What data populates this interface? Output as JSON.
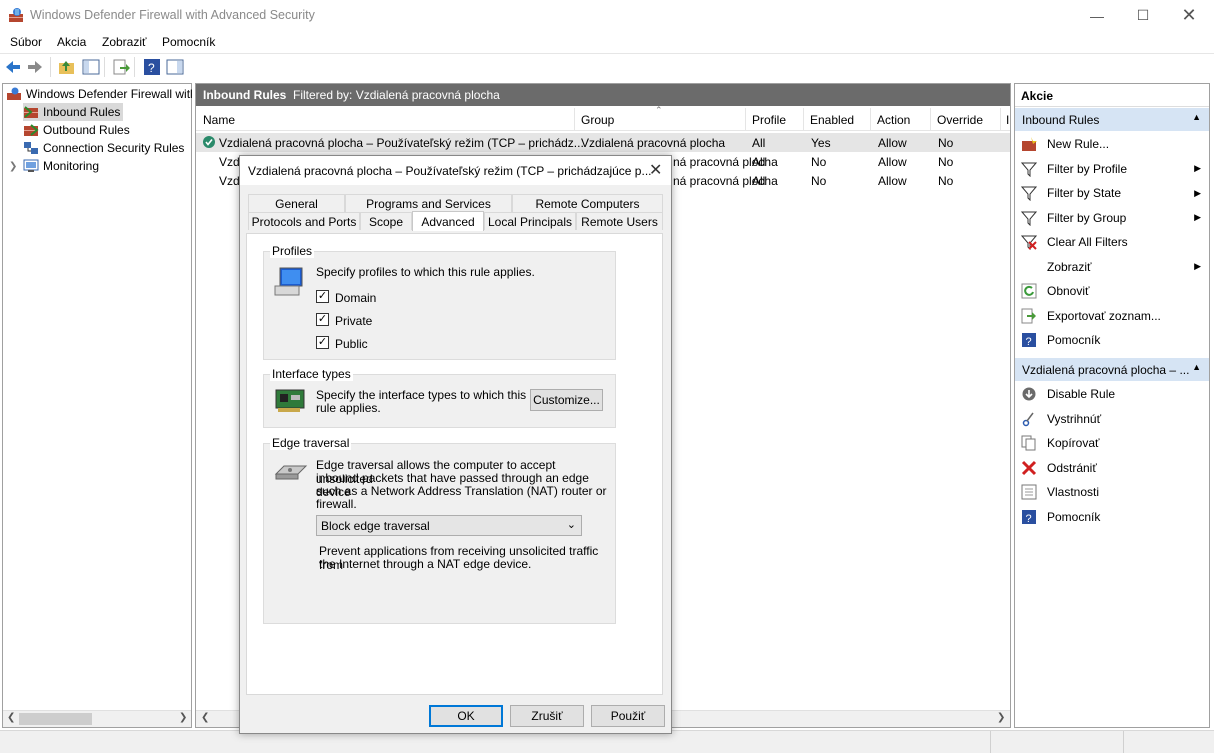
{
  "window": {
    "title": "Windows Defender Firewall with Advanced Security"
  },
  "menu": [
    "Súbor",
    "Akcia",
    "Zobraziť",
    "Pomocník"
  ],
  "tree": {
    "root": "Windows Defender Firewall witl",
    "items": [
      "Inbound Rules",
      "Outbound Rules",
      "Connection Security Rules",
      "Monitoring"
    ]
  },
  "center": {
    "header_title": "Inbound Rules",
    "header_filter": "Filtered by: Vzdialená pracovná plocha",
    "columns": [
      "Name",
      "Group",
      "Profile",
      "Enabled",
      "Action",
      "Override",
      "I"
    ],
    "rows": [
      {
        "name": "Vzdialená pracovná plocha – Používateľský režim (TCP – prichádz...",
        "group": "Vzdialená pracovná plocha",
        "profile": "All",
        "enabled": "Yes",
        "action": "Allow",
        "override": "No"
      },
      {
        "name": "Vzd",
        "group": "ná pracovná plocha",
        "profile": "All",
        "enabled": "No",
        "action": "Allow",
        "override": "No"
      },
      {
        "name": "Vzd",
        "group": "ná pracovná plocha",
        "profile": "All",
        "enabled": "No",
        "action": "Allow",
        "override": "No"
      }
    ]
  },
  "actions": {
    "title": "Akcie",
    "section1": "Inbound Rules",
    "items1": [
      {
        "label": "New Rule...",
        "icon": "new-rule-icon"
      },
      {
        "label": "Filter by Profile",
        "icon": "filter-icon",
        "submenu": true
      },
      {
        "label": "Filter by State",
        "icon": "filter-icon",
        "submenu": true
      },
      {
        "label": "Filter by Group",
        "icon": "filter-icon",
        "submenu": true
      },
      {
        "label": "Clear All Filters",
        "icon": "clear-filter-icon"
      },
      {
        "label": "Zobraziť",
        "icon": "none",
        "submenu": true
      },
      {
        "label": "Obnoviť",
        "icon": "refresh-icon"
      },
      {
        "label": "Exportovať zoznam...",
        "icon": "export-icon"
      },
      {
        "label": "Pomocník",
        "icon": "help-icon"
      }
    ],
    "section2": "Vzdialená pracovná plocha – ...",
    "items2": [
      {
        "label": "Disable Rule",
        "icon": "disable-icon"
      },
      {
        "label": "Vystrihnúť",
        "icon": "cut-icon"
      },
      {
        "label": "Kopírovať",
        "icon": "copy-icon"
      },
      {
        "label": "Odstrániť",
        "icon": "delete-icon"
      },
      {
        "label": "Vlastnosti",
        "icon": "properties-icon"
      },
      {
        "label": "Pomocník",
        "icon": "help-icon"
      }
    ]
  },
  "dialog": {
    "title": "Vzdialená pracovná plocha – Používateľský režim (TCP – prichádzajúce p...",
    "tabs_row1": [
      "General",
      "Programs and Services",
      "Remote Computers"
    ],
    "tabs_row2": [
      "Protocols and Ports",
      "Scope",
      "Advanced",
      "Local Principals",
      "Remote Users"
    ],
    "profiles": {
      "label": "Profiles",
      "desc": "Specify profiles to which this rule applies.",
      "options": [
        {
          "label": "Domain",
          "checked": true
        },
        {
          "label": "Private",
          "checked": true
        },
        {
          "label": "Public",
          "checked": true
        }
      ]
    },
    "interface": {
      "label": "Interface types",
      "desc_line1": "Specify the interface types to which this",
      "desc_line2": "rule applies.",
      "button": "Customize..."
    },
    "edge": {
      "label": "Edge traversal",
      "desc_lines": [
        "Edge traversal allows the computer to accept unsolicited",
        "inbound packets that have passed through an edge device",
        "such as a Network Address Translation (NAT) router or",
        "firewall."
      ],
      "select_value": "Block edge traversal",
      "note_lines": [
        "Prevent applications from receiving unsolicited traffic from",
        "the Internet through a NAT edge device."
      ]
    },
    "buttons": {
      "ok": "OK",
      "cancel": "Zrušiť",
      "apply": "Použiť"
    }
  }
}
